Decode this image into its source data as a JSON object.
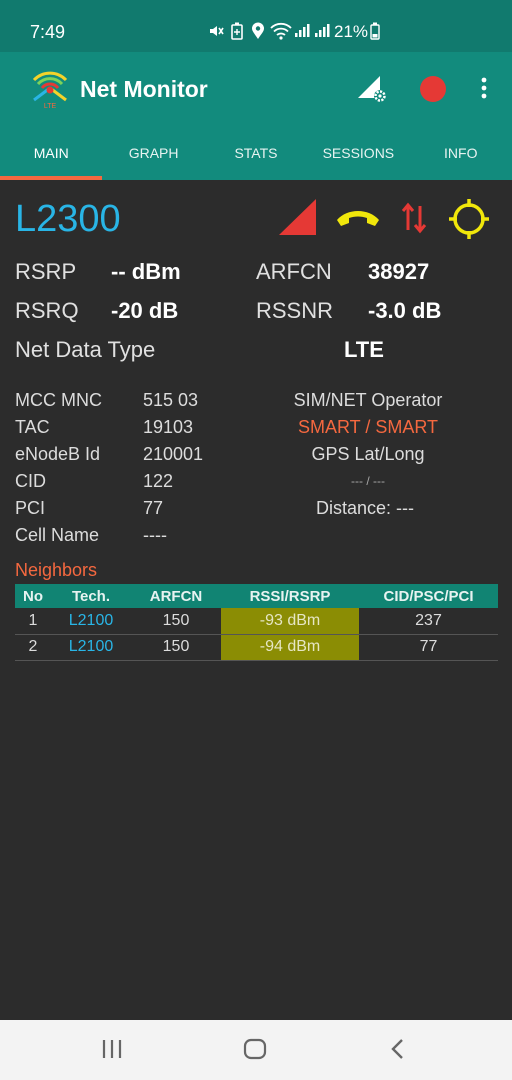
{
  "status_bar": {
    "time": "7:49",
    "battery_percent": "21%",
    "icons": [
      "mute-icon",
      "battery-saver-icon",
      "location-icon",
      "wifi-icon",
      "signal-icon",
      "signal-icon",
      "battery-icon"
    ]
  },
  "app": {
    "title": "Net Monitor",
    "logo_label": "LTE"
  },
  "tabs": [
    {
      "label": "MAIN",
      "active": true
    },
    {
      "label": "GRAPH",
      "active": false
    },
    {
      "label": "STATS",
      "active": false
    },
    {
      "label": "SESSIONS",
      "active": false
    },
    {
      "label": "INFO",
      "active": false
    }
  ],
  "main": {
    "technology": "L2300",
    "rsrp_label": "RSRP",
    "rsrp_value": "-- dBm",
    "arfcn_label": "ARFCN",
    "arfcn_value": "38927",
    "rsrq_label": "RSRQ",
    "rsrq_value": "-20 dB",
    "rssnr_label": "RSSNR",
    "rssnr_value": "-3.0 dB",
    "net_data_type_label": "Net Data Type",
    "net_data_type_value": "LTE",
    "details": {
      "mcc_mnc_label": "MCC MNC",
      "mcc_mnc_value": "515 03",
      "tac_label": "TAC",
      "tac_value": "19103",
      "enodeb_label": "eNodeB Id",
      "enodeb_value": "210001",
      "cid_label": "CID",
      "cid_value": "122",
      "pci_label": "PCI",
      "pci_value": "77",
      "cell_name_label": "Cell Name",
      "cell_name_value": "----",
      "operator_label": "SIM/NET Operator",
      "operator_value": "SMART / SMART",
      "gps_label": "GPS Lat/Long",
      "gps_value": "--- / ---",
      "distance": "Distance: ---"
    }
  },
  "neighbors": {
    "title": "Neighbors",
    "headers": [
      "No",
      "Tech.",
      "ARFCN",
      "RSSI/RSRP",
      "CID/PSC/PCI"
    ],
    "rows": [
      {
        "no": "1",
        "tech": "L2100",
        "arfcn": "150",
        "rssi": "-93 dBm",
        "cid": "237"
      },
      {
        "no": "2",
        "tech": "L2100",
        "arfcn": "150",
        "rssi": "-94 dBm",
        "cid": "77"
      }
    ]
  },
  "colors": {
    "accent": "#f5683f",
    "app_bar": "#128b7d",
    "tech_blue": "#29b5e6",
    "signal_red": "#e53935",
    "call_yellow": "#f1e70b"
  }
}
